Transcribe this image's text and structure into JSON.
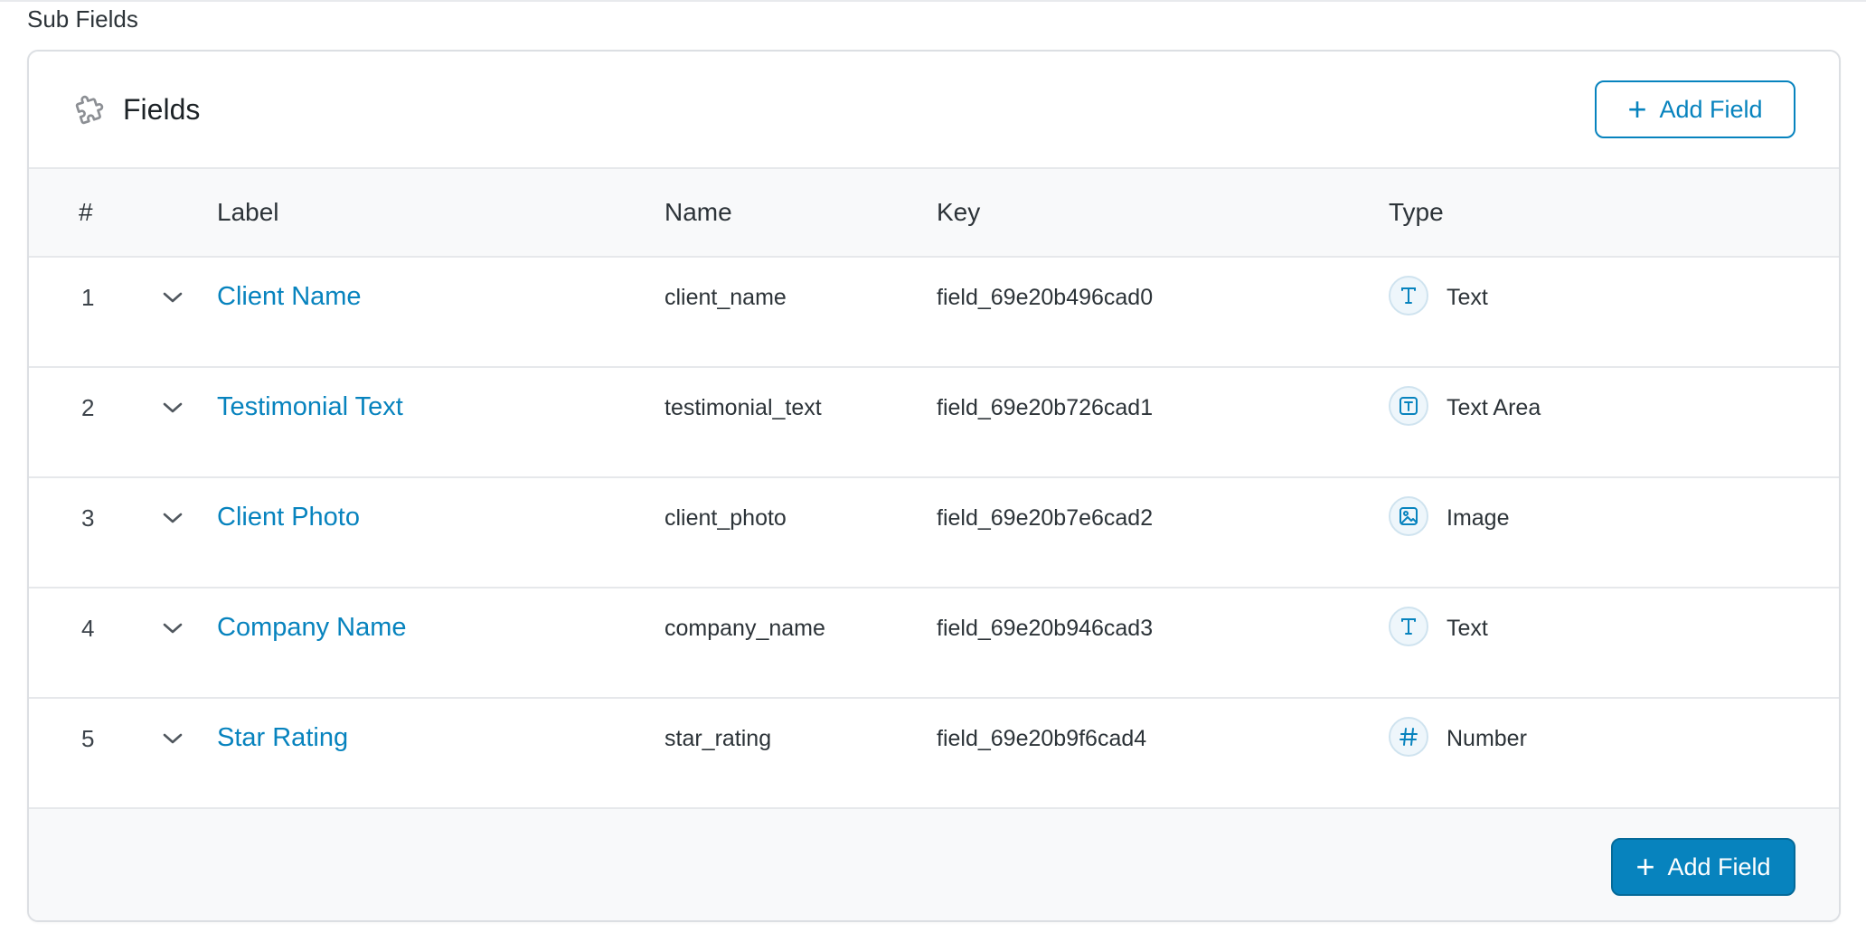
{
  "section": {
    "title": "Sub Fields"
  },
  "panel": {
    "title": "Fields",
    "add_field_top_label": "Add Field",
    "add_field_bottom_label": "Add Field"
  },
  "table": {
    "headers": {
      "num": "#",
      "label": "Label",
      "name": "Name",
      "key": "Key",
      "type": "Type"
    },
    "rows": [
      {
        "num": "1",
        "label": "Client Name",
        "name": "client_name",
        "key": "field_69e20b496cad0",
        "type": "Text",
        "type_icon": "text-icon"
      },
      {
        "num": "2",
        "label": "Testimonial Text",
        "name": "testimonial_text",
        "key": "field_69e20b726cad1",
        "type": "Text Area",
        "type_icon": "textarea-icon"
      },
      {
        "num": "3",
        "label": "Client Photo",
        "name": "client_photo",
        "key": "field_69e20b7e6cad2",
        "type": "Image",
        "type_icon": "image-icon"
      },
      {
        "num": "4",
        "label": "Company Name",
        "name": "company_name",
        "key": "field_69e20b946cad3",
        "type": "Text",
        "type_icon": "text-icon"
      },
      {
        "num": "5",
        "label": "Star Rating",
        "name": "star_rating",
        "key": "field_69e20b9f6cad4",
        "type": "Number",
        "type_icon": "number-icon"
      }
    ]
  },
  "colors": {
    "accent": "#0783be",
    "border": "#dcdfe3",
    "header_bg": "#f8f9fa"
  }
}
